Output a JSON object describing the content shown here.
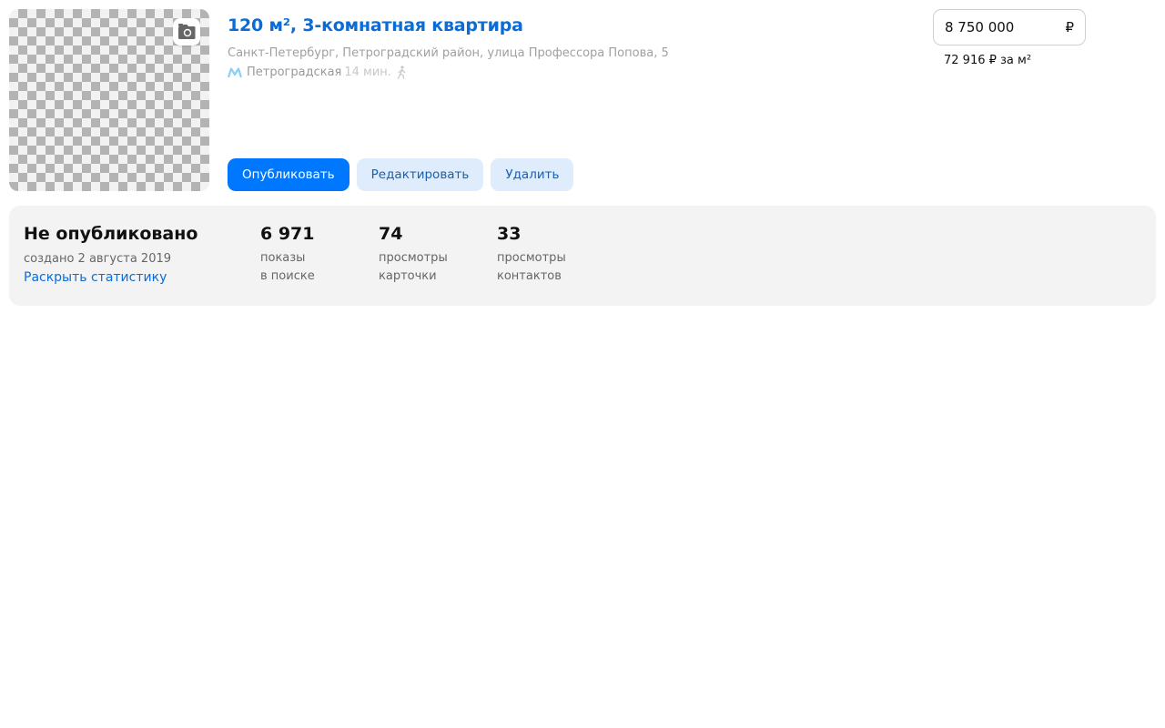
{
  "listing": {
    "title": "120 м², 3-комнатная квартира",
    "address": "Санкт-Петербург, Петроградский район, улица Профессора Попова, 5",
    "metro": {
      "station": "Петроградская",
      "time": "14 мин.",
      "icon": "metro-icon",
      "walk_icon": "walking-person-icon",
      "metro_color": "#8ad0f5"
    },
    "photo_icon": "camera-icon"
  },
  "price": {
    "value": "8 750 000",
    "currency": "₽",
    "per_meter": "72 916 ₽ за м²"
  },
  "actions": {
    "publish": "Опубликовать",
    "edit": "Редактировать",
    "delete": "Удалить"
  },
  "stats": {
    "status": "Не опубликовано",
    "created": "создано 2 августа 2019",
    "expand_link": "Раскрыть статистику",
    "metrics": [
      {
        "value": "6 971",
        "label_line1": "показы",
        "label_line2": "в поиске"
      },
      {
        "value": "74",
        "label_line1": "просмотры",
        "label_line2": "карточки"
      },
      {
        "value": "33",
        "label_line1": "просмотры",
        "label_line2": "контактов"
      }
    ]
  },
  "colors": {
    "accent": "#0077ff",
    "link": "#0a6dd6",
    "secondary_button_bg": "#deecfc",
    "stats_bg": "#f3f3f3"
  }
}
